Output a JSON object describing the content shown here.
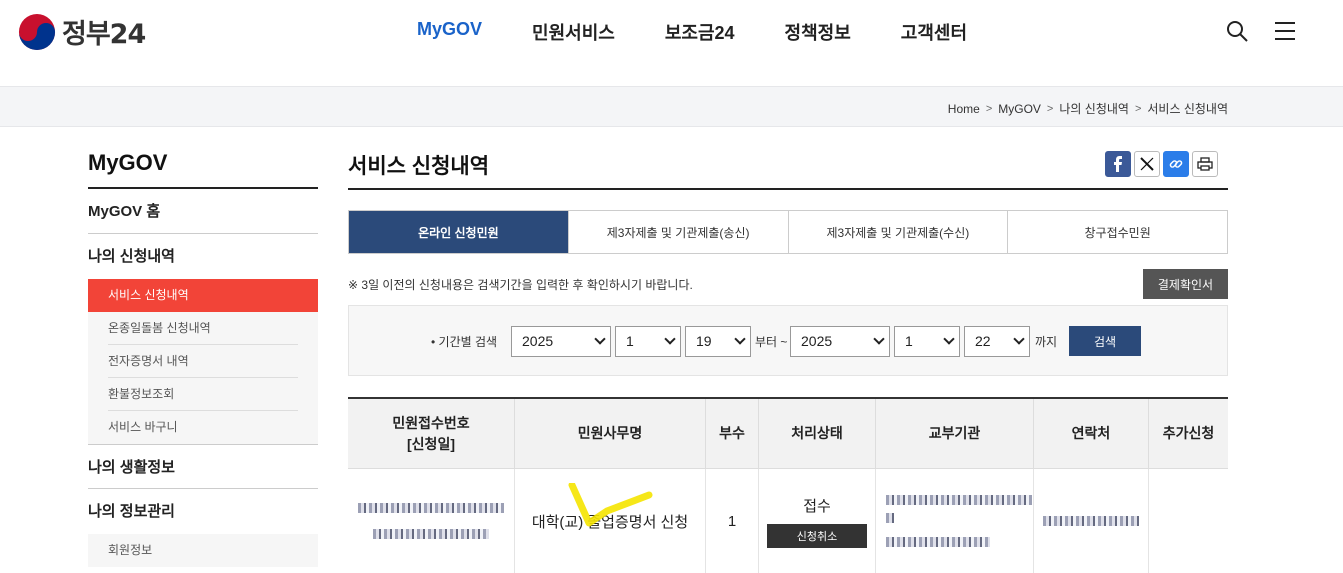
{
  "header": {
    "logo_text": "정부24",
    "nav": [
      "MyGOV",
      "민원서비스",
      "보조금24",
      "정책정보",
      "고객센터"
    ],
    "active_nav": "MyGOV"
  },
  "breadcrumb": [
    "Home",
    "MyGOV",
    "나의 신청내역",
    "서비스 신청내역"
  ],
  "lnb": {
    "title": "MyGOV",
    "home": "MyGOV 홈",
    "section1": "나의 신청내역",
    "active_sub": "서비스 신청내역",
    "subs": [
      "온종일돌봄 신청내역",
      "전자증명서 내역",
      "환불정보조회",
      "서비스 바구니"
    ],
    "section2": "나의 생활정보",
    "section3": "나의 정보관리",
    "section3_subs": [
      "회원정보"
    ]
  },
  "content": {
    "title": "서비스 신청내역",
    "tabs": [
      "온라인 신청민원",
      "제3자제출 및 기관제출(송신)",
      "제3자제출 및 기관제출(수신)",
      "창구접수민원"
    ],
    "notice": "※ 3일 이전의 신청내용은 검색기간을 입력한 후 확인하시기 바랍니다.",
    "pay_button": "결제확인서",
    "search": {
      "label": "기간별 검색",
      "from_year": "2025",
      "from_month": "1",
      "from_day": "19",
      "from_text": "부터 ~",
      "to_year": "2025",
      "to_month": "1",
      "to_day": "22",
      "to_text": "까지",
      "button": "검색"
    },
    "table": {
      "headers": [
        "민원접수번호\n[신청일]",
        "민원사무명",
        "부수",
        "처리상태",
        "교부기관",
        "연락처",
        "추가신청"
      ],
      "header_line1": "민원접수번호",
      "header_line2": "[신청일]",
      "rows": [
        {
          "name": "대학(교) 졸업증명서 신청",
          "copies": "1",
          "status": "접수",
          "cancel": "신청취소"
        }
      ]
    }
  },
  "colors": {
    "accent": "#1a63c9",
    "active_red": "#f24438",
    "navy": "#2b4a7a"
  }
}
